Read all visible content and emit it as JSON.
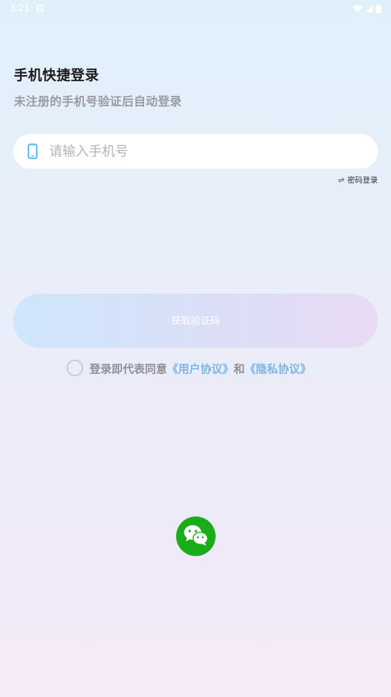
{
  "status_bar": {
    "time": "3:21"
  },
  "login": {
    "title": "手机快捷登录",
    "subtitle": "未注册的手机号验证后自动登录",
    "phone_placeholder": "请输入手机号",
    "password_login_label": "密码登录",
    "swap_glyph": "⇌",
    "get_code_label": "获取验证码"
  },
  "agreement": {
    "prefix": "登录即代表同意",
    "user_agreement": "《用户协议》",
    "conjunction": "和",
    "privacy_policy": "《隐私协议》"
  },
  "colors": {
    "accent_link": "#7ab6e6",
    "phone_icon": "#5ec0ec",
    "wechat_green": "#1aad19"
  },
  "icons": {
    "phone": "phone-icon",
    "wechat": "wechat-icon",
    "swap": "swap-icon",
    "wifi": "wifi-icon",
    "signal": "signal-icon",
    "battery": "battery-icon"
  }
}
